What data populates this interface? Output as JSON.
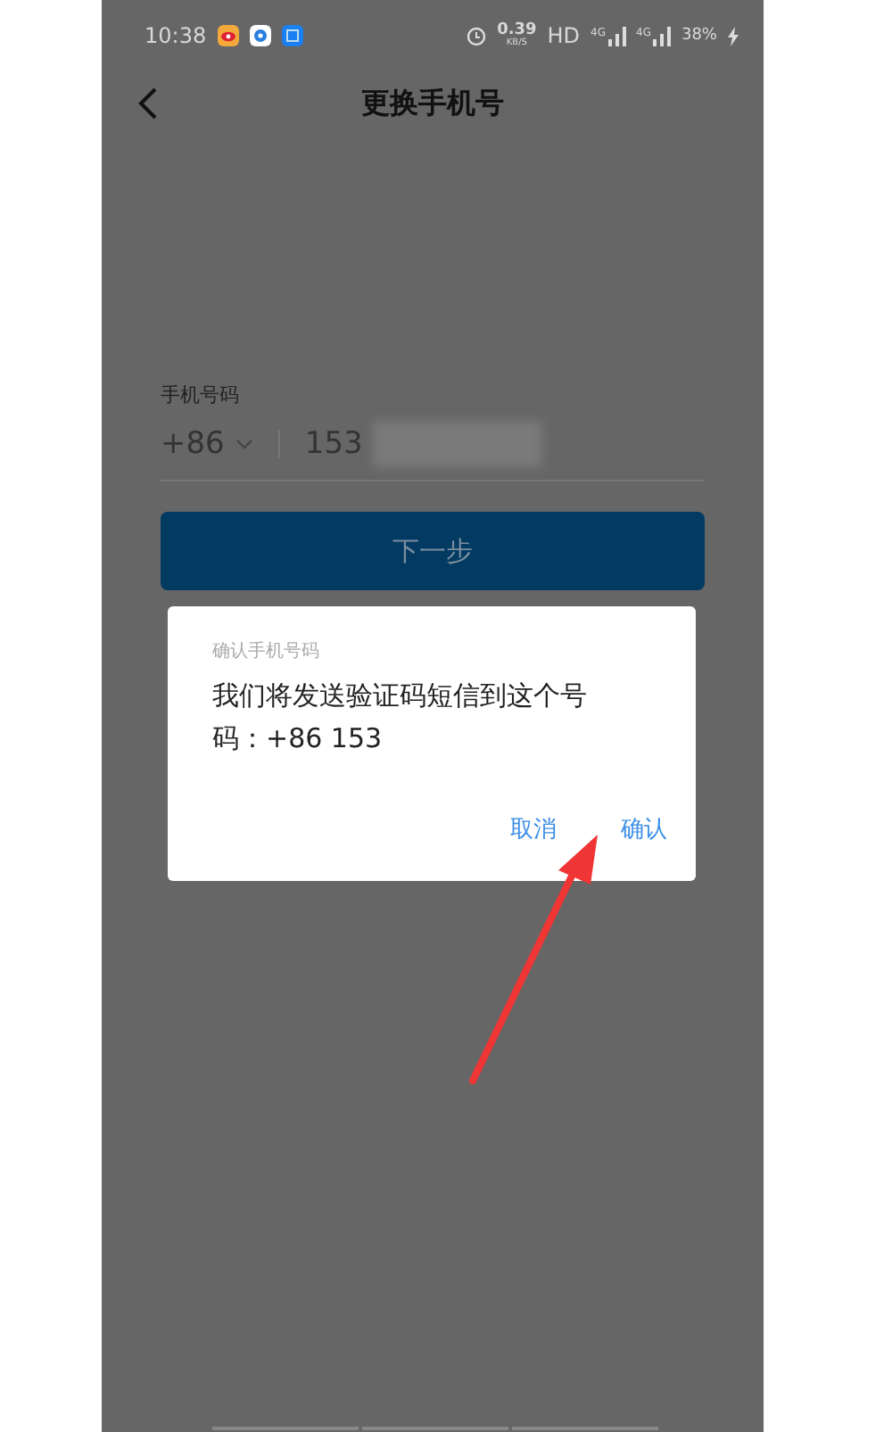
{
  "status_bar": {
    "time": "10:38",
    "speed_value": "0.39",
    "speed_unit": "KB/S",
    "hd": "HD",
    "network_1": "4G",
    "network_2": "4G",
    "battery": "38%"
  },
  "header": {
    "title": "更换手机号"
  },
  "form": {
    "label": "手机号码",
    "country_code": "+86",
    "phone_value": "153",
    "next_button": "下一步"
  },
  "dialog": {
    "title": "确认手机号码",
    "message": "我们将发送验证码短信到这个号码：+86 153",
    "buttons": [
      {
        "label": "取消"
      },
      {
        "label": "确认"
      }
    ]
  }
}
